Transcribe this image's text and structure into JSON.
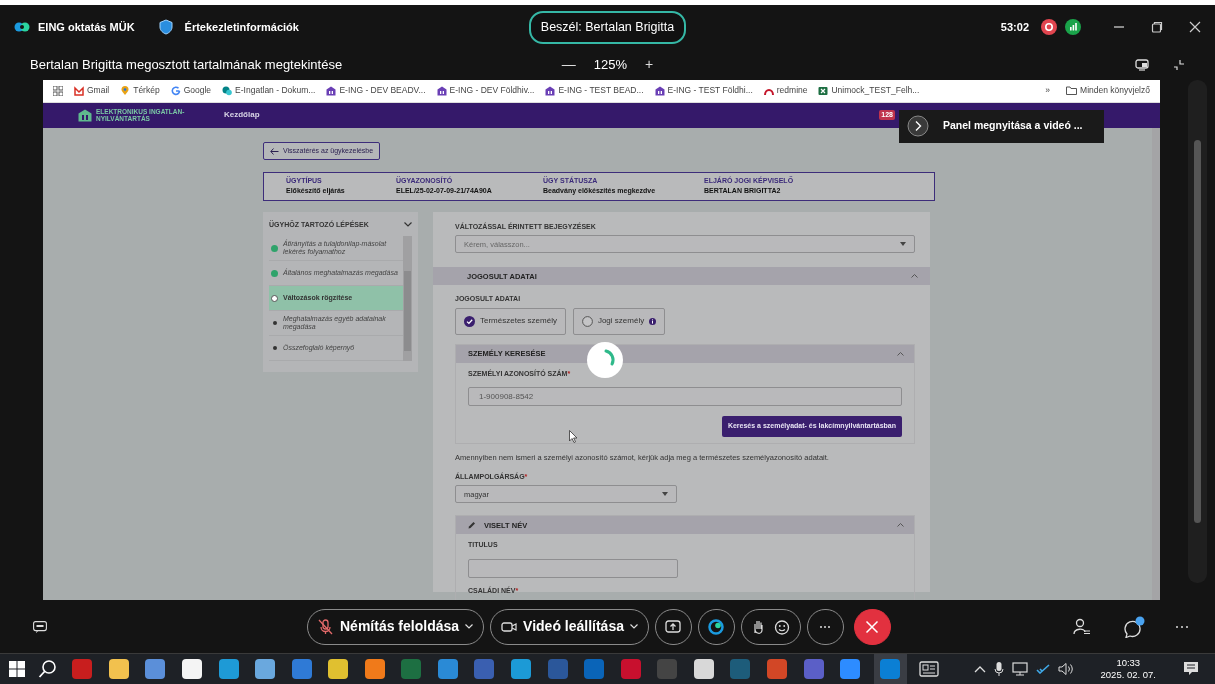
{
  "meeting": {
    "name": "EING oktatás MÜK",
    "info": "Értekezletinformációk",
    "speaker": "Beszél: Bertalan Brigitta",
    "timer": "53:02"
  },
  "share_bar": {
    "title": "Bertalan Brigitta megosztott tartalmának megtekintése",
    "zoom_out": "—",
    "zoom": "125%",
    "zoom_in": "+"
  },
  "browser": {
    "bookmarks": [
      {
        "label": "Gmail",
        "kind": "gmail"
      },
      {
        "label": "Térkép",
        "kind": "maps"
      },
      {
        "label": "Google",
        "kind": "google"
      },
      {
        "label": "E-Ingatlan - Dokum...",
        "kind": "sharepoint"
      },
      {
        "label": "E-ING - DEV BEADV...",
        "kind": "house"
      },
      {
        "label": "E-ING - DEV Földhiv...",
        "kind": "house"
      },
      {
        "label": "E-ING - TEST BEAD...",
        "kind": "house"
      },
      {
        "label": "E-ING - TEST  Földhi...",
        "kind": "house"
      },
      {
        "label": "redmine",
        "kind": "redmine"
      },
      {
        "label": "Unimock_TEST_Felh...",
        "kind": "excel"
      }
    ],
    "overflow": "»",
    "all_bookmarks": "Minden könyvjelző"
  },
  "app": {
    "logo": "ELEKTRONIKUS INGATLAN-NYILVÁNTARTÁS",
    "nav": "Kezdőlap",
    "notification_count": "128",
    "back": "Visszatérés az ügykezelésbe",
    "case_info": [
      {
        "label": "ÜGYTÍPUS",
        "value": "Előkészítő eljárás"
      },
      {
        "label": "ÜGYAZONOSÍTÓ",
        "value": "ELEL/25-02-07-09-21/74A90A"
      },
      {
        "label": "ÜGY STÁTUSZA",
        "value": "Beadvány előkészítés megkezdve"
      },
      {
        "label": "ELJÁRÓ JOGI KÉPVISELŐ",
        "value": "BERTALAN BRIGITTA2"
      }
    ],
    "steps": {
      "title": "ÜGYHÖZ TARTOZÓ LÉPÉSEK",
      "items": [
        {
          "label": "Átirányítás a tulajdonilap-másolat lekérés folyamathoz",
          "kind": "done",
          "selected": false
        },
        {
          "label": "Általános meghatalmazás megadása",
          "kind": "done",
          "selected": false
        },
        {
          "label": "Változások rögzítése",
          "kind": "current",
          "selected": true
        },
        {
          "label": "Meghatalmazás egyéb adatainak megadása",
          "kind": "pending",
          "selected": false
        },
        {
          "label": "Összefoglaló képernyő",
          "kind": "pending",
          "selected": false
        }
      ]
    },
    "form": {
      "affected": {
        "label": "VÁLTOZÁSSAL ÉRINTETT BEJEGYZÉSEK",
        "placeholder": "Kérem, válasszon..."
      },
      "section": "JOGOSULT ADATAI",
      "person_type": {
        "label": "JOGOSULT ADATAI",
        "options": [
          {
            "label": "Természetes személy",
            "selected": true,
            "info": false
          },
          {
            "label": "Jogi személy",
            "selected": false,
            "info": true
          }
        ]
      },
      "search": {
        "title": "SZEMÉLY KERESÉSE",
        "id_label": "SZEMÉLYI AZONOSÍTÓ SZÁM",
        "required_mark": "*",
        "id_value": "1-900908-8542",
        "button": "Keresés a személyadat- és lakcímnyilvántartásban"
      },
      "note": "Amennyiben nem ismeri a személyi azonosító számot, kérjük adja meg a természetes személyazonosító adatait.",
      "citizenship": {
        "label": "ÁLLAMPOLGÁRSÁG",
        "required_mark": "*",
        "value": "magyar"
      },
      "name_section": {
        "title": "VISELT NÉV",
        "title_label": "TITULUS",
        "family_label": "CSALÁDI NÉV",
        "family_required_mark": "*"
      }
    }
  },
  "tooltip": "Panel megnyitása a videó ...",
  "controls": {
    "unmute": "Némítás feloldása",
    "video": "Videó leállítása"
  },
  "taskbar": {
    "time": "10:33",
    "date": "2025. 02. 07."
  }
}
